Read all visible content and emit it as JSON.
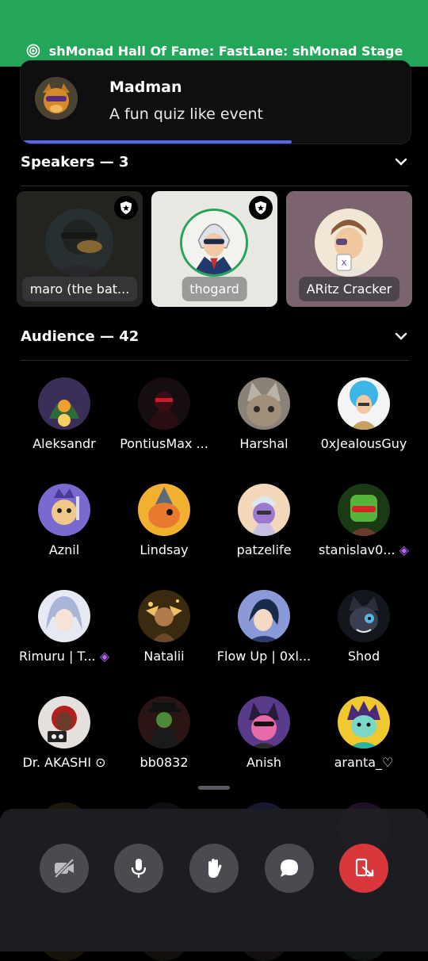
{
  "stage": {
    "title": "shMonad Hall Of Fame: FastLane: shMonad Stage",
    "icon": "stage-icon"
  },
  "event": {
    "host": "Madman",
    "description": "A fun quiz like event"
  },
  "speakers": {
    "label": "Speakers — 3",
    "items": [
      {
        "name": "maro (the bat...",
        "moderator": true
      },
      {
        "name": "thogard",
        "moderator": true
      },
      {
        "name": "ARitz Cracker",
        "moderator": false
      }
    ]
  },
  "audience": {
    "label": "Audience — 42",
    "members": [
      {
        "name": "Aleksandr"
      },
      {
        "name": "PontiusMax ..."
      },
      {
        "name": "Harshal"
      },
      {
        "name": "0xJealousGuy"
      },
      {
        "name": "Aznil"
      },
      {
        "name": "Lindsay"
      },
      {
        "name": "patzelife"
      },
      {
        "name": "stanislav0..."
      },
      {
        "name": "Rimuru | T..."
      },
      {
        "name": "Natalii"
      },
      {
        "name": "Flow Up | 0xl..."
      },
      {
        "name": "Shod"
      },
      {
        "name": "Dr. AKASHI"
      },
      {
        "name": "bb0832"
      },
      {
        "name": "Anish"
      },
      {
        "name": "aranta_♡"
      }
    ]
  },
  "controls": [
    {
      "name": "camera-off-button",
      "icon": "camera-off-icon"
    },
    {
      "name": "microphone-button",
      "icon": "microphone-icon"
    },
    {
      "name": "raise-hand-button",
      "icon": "hand-icon"
    },
    {
      "name": "chat-button",
      "icon": "chat-bubble-icon"
    },
    {
      "name": "leave-stage-button",
      "icon": "leave-icon"
    }
  ],
  "colors": {
    "accent": "#5865f2",
    "status_green": "#23a55a",
    "danger": "#da373c",
    "boost_gem": "#b565f5"
  }
}
